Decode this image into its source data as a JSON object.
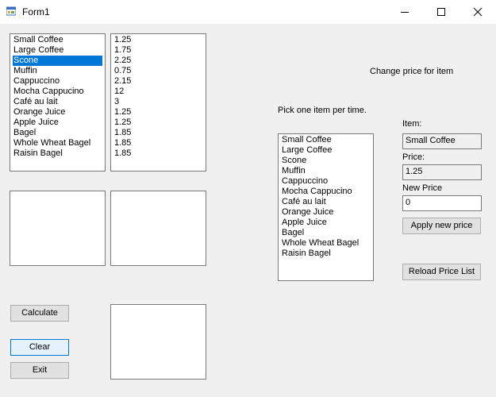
{
  "window": {
    "title": "Form1",
    "icon": "winforms-app-icon"
  },
  "menu_items": [
    "Small Coffee",
    "Large Coffee",
    "Scone",
    "Muffin",
    "Cappuccino",
    "Mocha Cappucino",
    "Café au lait",
    "Orange Juice",
    "Apple Juice",
    "Bagel",
    "Whole Wheat Bagel",
    "Raisin Bagel"
  ],
  "menu_prices": [
    "1.25",
    "1.75",
    "2.25",
    "0.75",
    "2.15",
    "12",
    "3",
    "1.25",
    "1.25",
    "1.85",
    "1.85",
    "1.85"
  ],
  "selected_item_index": 2,
  "buttons": {
    "calculate": "Calculate",
    "clear": "Clear",
    "exit": "Exit",
    "apply": "Apply new price",
    "reload": "Reload Price List"
  },
  "editor": {
    "heading": "Change price for item",
    "instruction": "Pick one item per time.",
    "item_label": "Item:",
    "item_value": "Small Coffee",
    "price_label": "Price:",
    "price_value": "1.25",
    "new_price_label": "New Price",
    "new_price_value": "0",
    "items": [
      "Small Coffee",
      "Large Coffee",
      "Scone",
      "Muffin",
      "Cappuccino",
      "Mocha Cappucino",
      "Café au lait",
      "Orange Juice",
      "Apple Juice",
      "Bagel",
      "Whole Wheat Bagel",
      "Raisin Bagel"
    ]
  },
  "colors": {
    "selection": "#0078d7",
    "form_background": "#f0f0f0"
  }
}
